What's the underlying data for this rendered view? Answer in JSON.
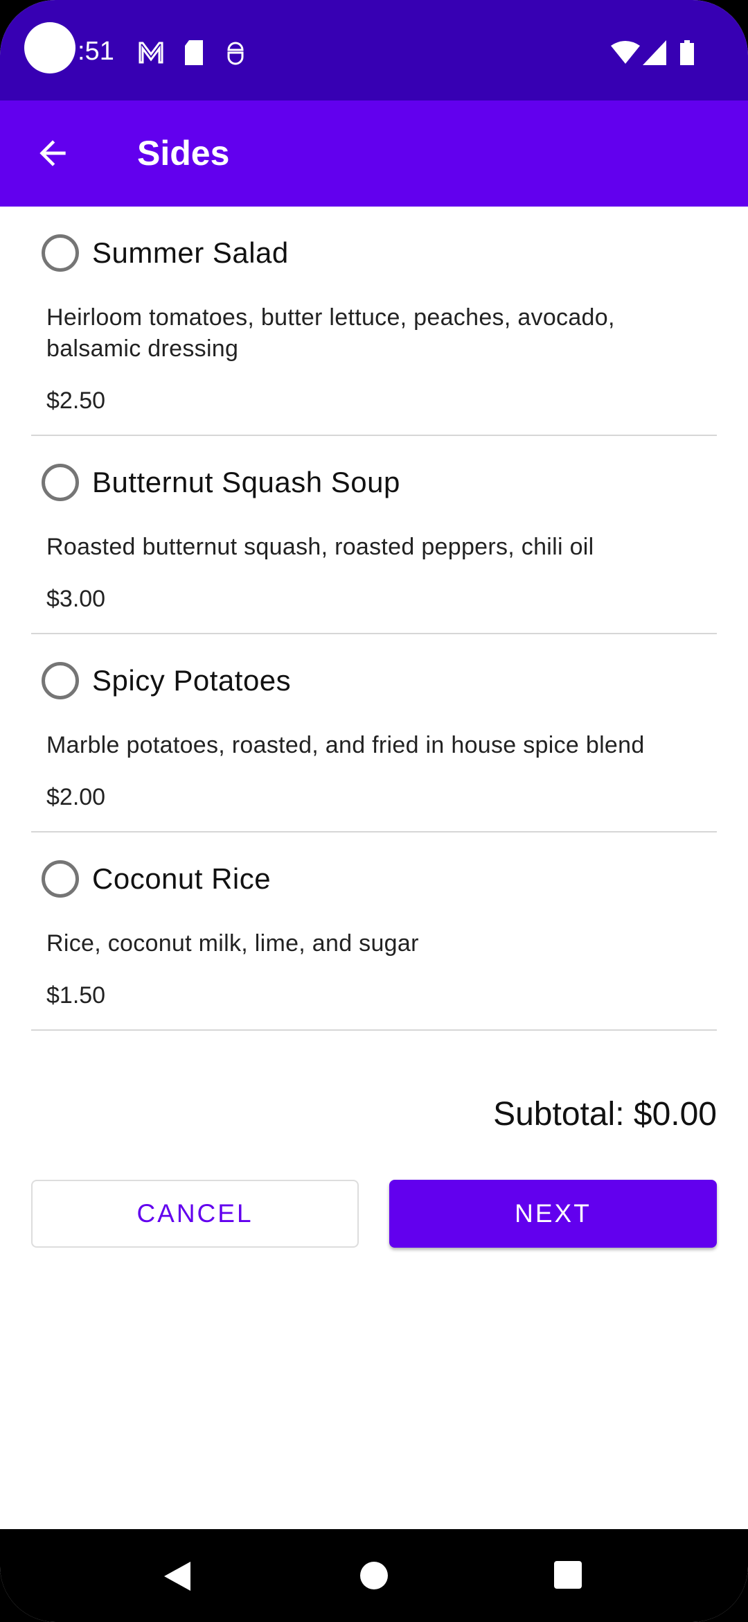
{
  "status_bar": {
    "time": ":51",
    "icons": [
      "gmail-icon",
      "sd-card-icon",
      "android-debug-icon",
      "wifi-icon",
      "signal-icon",
      "battery-icon"
    ]
  },
  "toolbar": {
    "title": "Sides",
    "back_icon": "arrow-back-icon"
  },
  "items": [
    {
      "name": "Summer Salad",
      "description": "Heirloom tomatoes, butter lettuce, peaches, avocado, balsamic dressing",
      "price": "$2.50",
      "selected": false
    },
    {
      "name": "Butternut Squash Soup",
      "description": "Roasted butternut squash, roasted peppers, chili oil",
      "price": "$3.00",
      "selected": false
    },
    {
      "name": "Spicy Potatoes",
      "description": "Marble potatoes, roasted, and fried in house spice blend",
      "price": "$2.00",
      "selected": false
    },
    {
      "name": "Coconut Rice",
      "description": "Rice, coconut milk, lime, and sugar",
      "price": "$1.50",
      "selected": false
    }
  ],
  "subtotal": "Subtotal: $0.00",
  "buttons": {
    "cancel": "CANCEL",
    "next": "NEXT"
  },
  "colors": {
    "primary": "#6200ee",
    "primary_dark": "#3700b3"
  }
}
